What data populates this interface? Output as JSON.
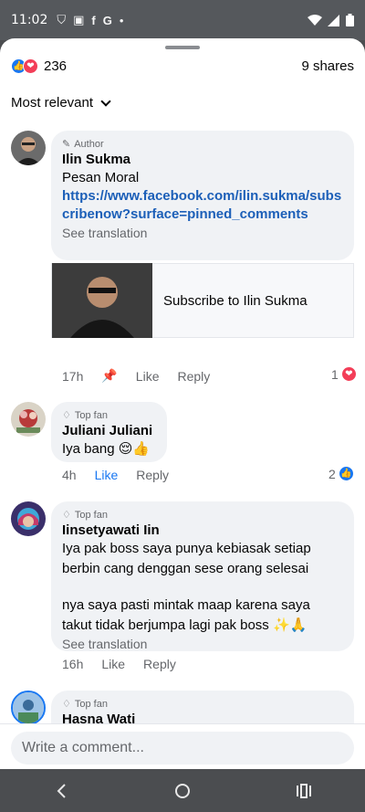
{
  "status_bar": {
    "time": "11:02",
    "icons": [
      "vpn-icon",
      "sim-icon",
      "facebook-icon",
      "google-icon",
      "dot-icon",
      "wifi-icon",
      "signal-icon",
      "battery-icon"
    ]
  },
  "post_stats": {
    "reaction_count": "236",
    "shares": "9 shares",
    "reactions": [
      "like",
      "love"
    ]
  },
  "sort": {
    "label": "Most relevant"
  },
  "comments": [
    {
      "badge": "Author",
      "name": "Ilin Sukma",
      "text": "Pesan Moral",
      "link": "https://www.facebook.com/ilin.sukma/subscribenow?surface=pinned_comments",
      "see_translation": "See translation",
      "card_label": "Subscribe to Ilin Sukma",
      "time": "17h",
      "like": "Like",
      "reply": "Reply",
      "reaction_count": "1",
      "reaction_type": "love"
    },
    {
      "badge": "Top fan",
      "name": "Juliani Juliani",
      "text": "Iya bang 😌👍",
      "time": "4h",
      "like": "Like",
      "reply": "Reply",
      "liked": true,
      "reaction_count": "2",
      "reaction_type": "like"
    },
    {
      "badge": "Top fan",
      "name": "Iinsetyawati Iin",
      "text_line1": "Iya pak boss saya punya kebiasak  setiap",
      "text_line2": "berbin cang denggan sese orang selesai",
      "text_line3": "nya saya pasti mintak maap karena saya",
      "text_line4": "takut tidak berjumpa lagi pak boss ✨🙏",
      "see_translation": "See translation",
      "time": "16h",
      "like": "Like",
      "reply": "Reply"
    },
    {
      "badge": "Top fan",
      "name": "Hasna Wati"
    }
  ],
  "composer": {
    "placeholder": "Write a comment..."
  },
  "nav": [
    "back-icon",
    "home-icon",
    "recents-icon"
  ],
  "colors": {
    "link": "#1c5fb8",
    "like_blue": "#1877f2",
    "love_red": "#f33e58",
    "bubble": "#f0f2f5"
  }
}
